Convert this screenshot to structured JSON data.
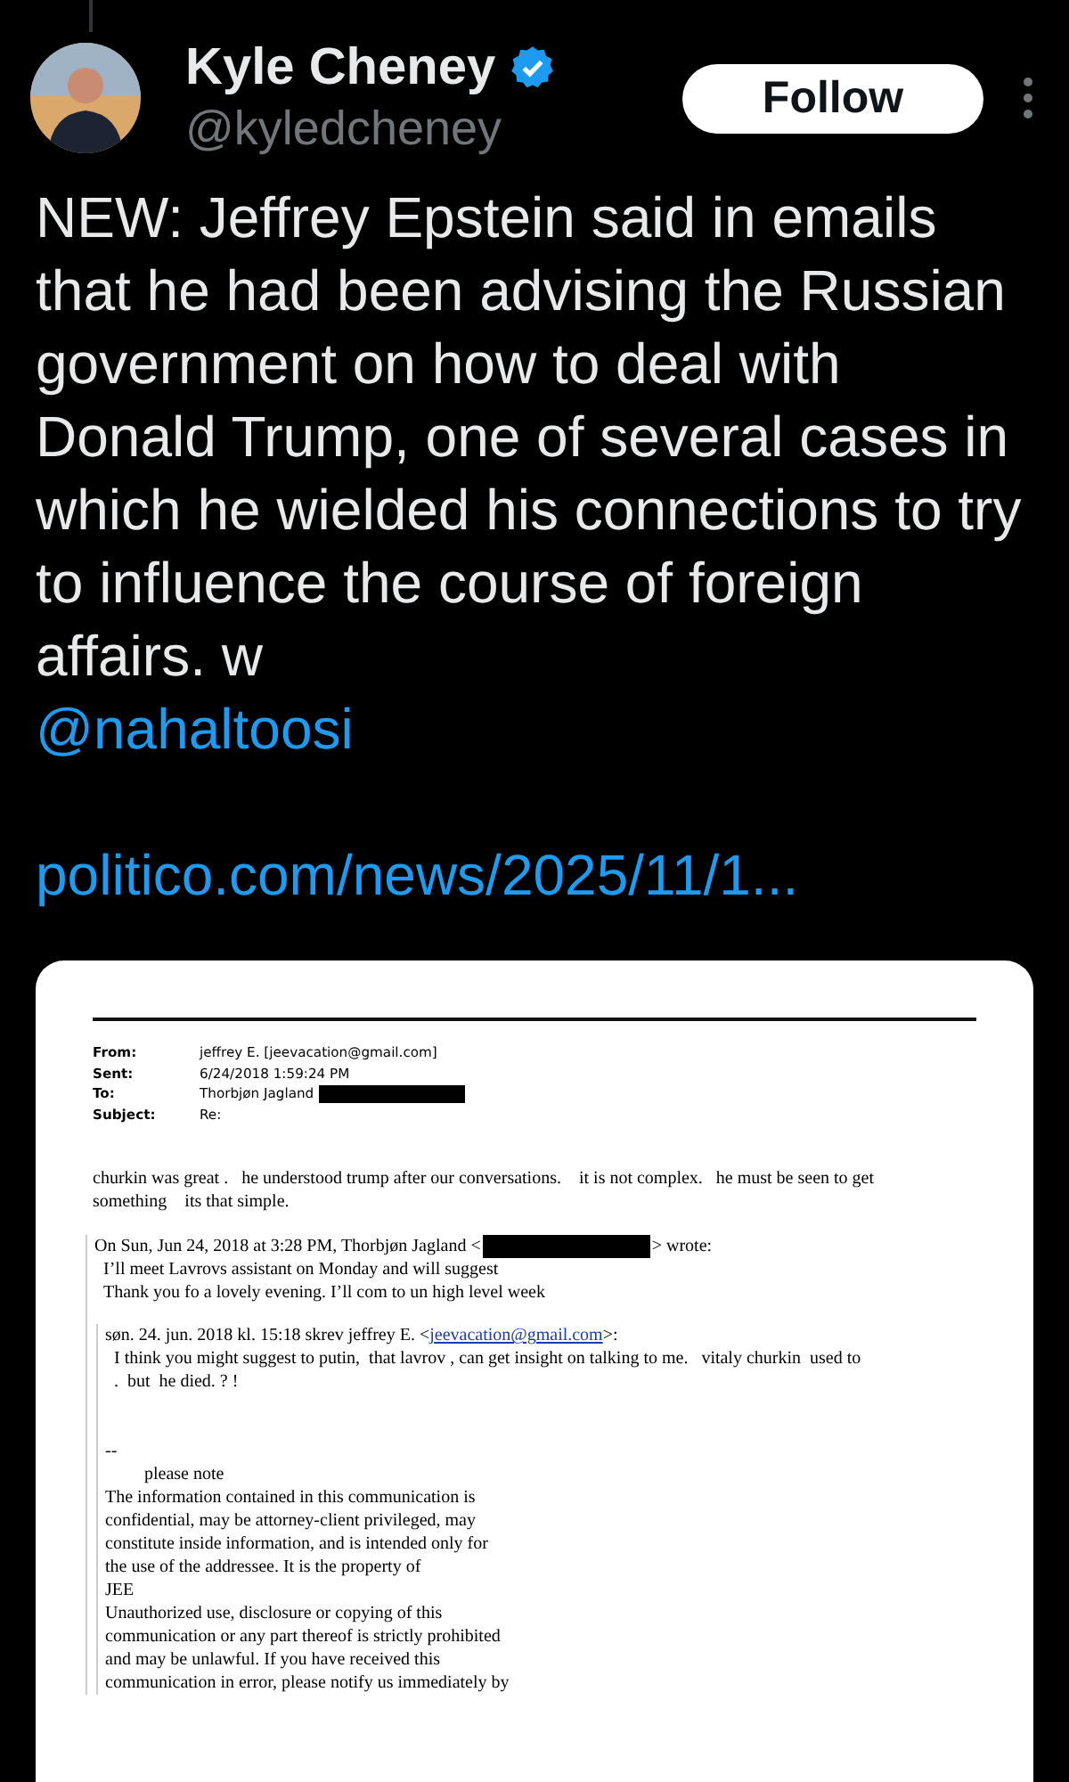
{
  "author": {
    "name": "Kyle Cheney",
    "handle": "@kyledcheney",
    "verified": true
  },
  "follow_button": "Follow",
  "tweet": {
    "text": "NEW: Jeffrey Epstein said in emails that he had been advising the Russian government on how to deal with Donald Trump, one of several cases in which he wielded his connections to try to influence the course of foreign affairs. w",
    "mention": "@nahaltoosi",
    "link": "politico.com/news/2025/11/1..."
  },
  "email": {
    "header": [
      {
        "label": "From:",
        "value": "jeffrey E. [jeevacation@gmail.com]",
        "redacted": false
      },
      {
        "label": "Sent:",
        "value": "6/24/2018 1:59:24 PM",
        "redacted": false
      },
      {
        "label": "To:",
        "value": "Thorbjøn Jagland",
        "redacted": true
      },
      {
        "label": "Subject:",
        "value": "Re:",
        "redacted": false
      }
    ],
    "body": [
      "churkin was great .   he understood trump after our conversations.    it is not complex.   he must be seen to get",
      "something    its that simple."
    ],
    "quote": {
      "intro": "On Sun, Jun 24, 2018 at 3:28 PM, Thorbjøn Jagland <",
      "redacted": true,
      "intro_end": "> wrote:",
      "lines": [
        "I’ll meet Lavrovs assistant on Monday and will suggest",
        "Thank you fo a lovely evening. I’ll com to un high level week"
      ],
      "quote": {
        "intro": "søn. 24. jun. 2018 kl. 15:18 skrev jeffrey E. <",
        "address": "jeevacation@gmail.com",
        "intro_end": ">:",
        "lines": [
          "I think you might suggest to putin,  that lavrov , can get insight on talking to me.   vitaly churkin  used to",
          ".  but  he died. ? !"
        ],
        "signature": [
          "--",
          "please note",
          "The information contained in this communication is",
          "confidential, may be attorney-client privileged, may",
          "constitute inside information, and is intended only for",
          "the use of the addressee. It is the property of",
          "JEE",
          "Unauthorized use, disclosure or copying of this",
          "communication or any part thereof is strictly prohibited",
          "and may be unlawful. If you have received this",
          "communication in error, please notify us immediately by"
        ]
      }
    }
  }
}
